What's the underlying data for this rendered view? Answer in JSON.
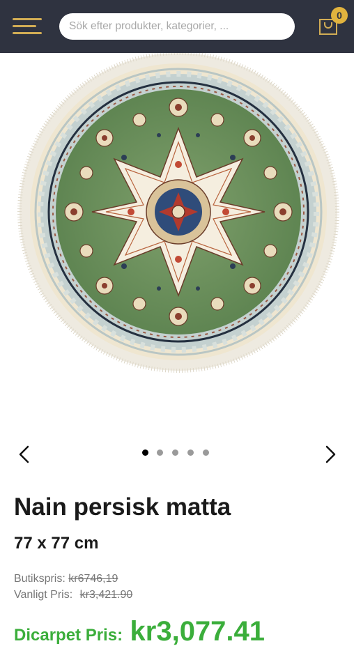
{
  "header": {
    "menu_icon": "hamburger-icon",
    "search_placeholder": "Sök efter produkter, kategorier, ...",
    "cart_icon": "shopping-bag-icon",
    "cart_count": "0",
    "accent_color": "#d2ad55",
    "background_color": "#2f3340"
  },
  "gallery": {
    "image": "round-persian-rug",
    "prev_icon": "chevron-left-icon",
    "next_icon": "chevron-right-icon",
    "slide_count": 5,
    "active_slide": 1
  },
  "product": {
    "title": "Nain persisk matta",
    "size": "77 x 77 cm",
    "store_price_label": "Butikspris:",
    "store_price": "kr6746,19",
    "regular_price_label": "Vanligt Pris:",
    "regular_price": "kr3,421.90",
    "final_price_label": "Dicarpet Pris:",
    "final_price": "kr3,077.41",
    "final_price_color": "#3bae3b"
  }
}
